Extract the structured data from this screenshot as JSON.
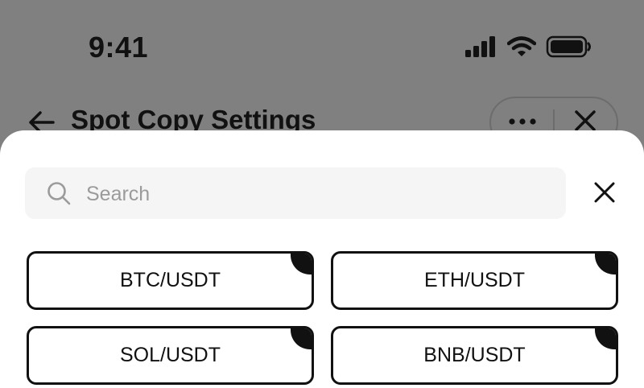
{
  "status_bar": {
    "time": "9:41",
    "icons": [
      "signal-icon",
      "wifi-icon",
      "battery-icon"
    ]
  },
  "header": {
    "title": "Spot Copy Settings",
    "icons": [
      "back-arrow-icon",
      "more-icon",
      "close-icon"
    ]
  },
  "sheet": {
    "search": {
      "placeholder": "Search",
      "value": ""
    },
    "pairs": [
      {
        "label": "BTC/USDT"
      },
      {
        "label": "ETH/USDT"
      },
      {
        "label": "SOL/USDT"
      },
      {
        "label": "BNB/USDT"
      }
    ]
  },
  "colors": {
    "overlay": "#808080",
    "sheet": "#ffffff",
    "search_bg": "#f5f5f5",
    "text": "#111111",
    "placeholder": "#9b9b9b"
  }
}
